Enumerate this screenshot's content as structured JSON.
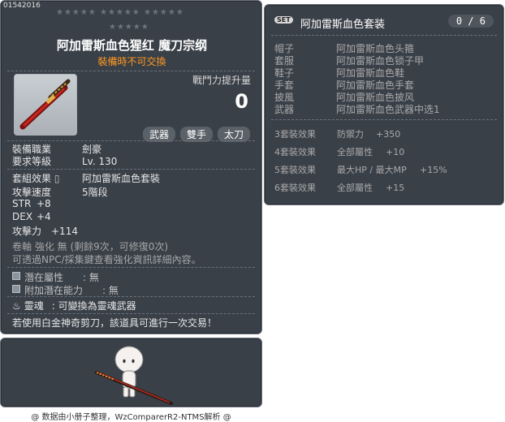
{
  "item": {
    "id": "01542016",
    "stars_row1": "★★★★★ ★★★★★ ★★★★★",
    "stars_row2": "★★★★★",
    "name": "阿加雷斯血色猩红 魔刀宗纲",
    "trade_note": "裝備時不可交換",
    "power_label": "戰鬥力提升量",
    "power_value": "0",
    "tags": [
      "武器",
      "雙手",
      "太刀"
    ],
    "job_label": "裝備職業",
    "job_value": "劍豪",
    "level_label": "要求等級",
    "level_value": "Lv. 130",
    "set_label": "套組效果",
    "set_value": "阿加雷斯血色套裝",
    "speed_label": "攻擊速度",
    "speed_value": "5階段",
    "str_label": "STR",
    "str_value": "+8",
    "dex_label": "DEX",
    "dex_value": "+4",
    "atk_label": "攻擊力",
    "atk_value": "+114",
    "scroll_line": "卷軸 強化 無 (剩餘9次，可修復0次)",
    "scroll_hint": "可透過NPC/採集鍵查看強化資訊詳細內容。",
    "potential_label": "潛在屬性",
    "potential_value": ": 無",
    "bonus_potential_label": "附加潛在能力",
    "bonus_potential_value": ": 無",
    "soul_label": "靈魂",
    "soul_value": ": 可變換為靈魂武器",
    "scissors_note": "若使用白金神奇剪刀，該道具可進行一次交易！"
  },
  "footer": {
    "credit": "@ 数据由小册子整理，WzComparerR2-NTMS解析 @"
  },
  "set": {
    "badge": "SET",
    "name": "阿加雷斯血色套装",
    "count": "0 / 6",
    "parts": [
      {
        "slot": "帽子",
        "name": "阿加雷斯血色头箍"
      },
      {
        "slot": "套服",
        "name": "阿加雷斯血色锁子甲"
      },
      {
        "slot": "鞋子",
        "name": "阿加雷斯血色鞋"
      },
      {
        "slot": "手套",
        "name": "阿加雷斯血色手套"
      },
      {
        "slot": "披風",
        "name": "阿加雷斯血色披风"
      },
      {
        "slot": "武器",
        "name": "阿加雷斯血色武器中选1"
      }
    ],
    "bonuses": [
      {
        "tier": "3套裝效果",
        "stat": "防禦力",
        "value": "+350"
      },
      {
        "tier": "4套裝效果",
        "stat": "全部屬性",
        "value": "+10"
      },
      {
        "tier": "5套裝效果",
        "stat": "最大HP / 最大MP",
        "value": "+15%"
      },
      {
        "tier": "6套裝效果",
        "stat": "全部屬性",
        "value": "+15"
      }
    ]
  }
}
